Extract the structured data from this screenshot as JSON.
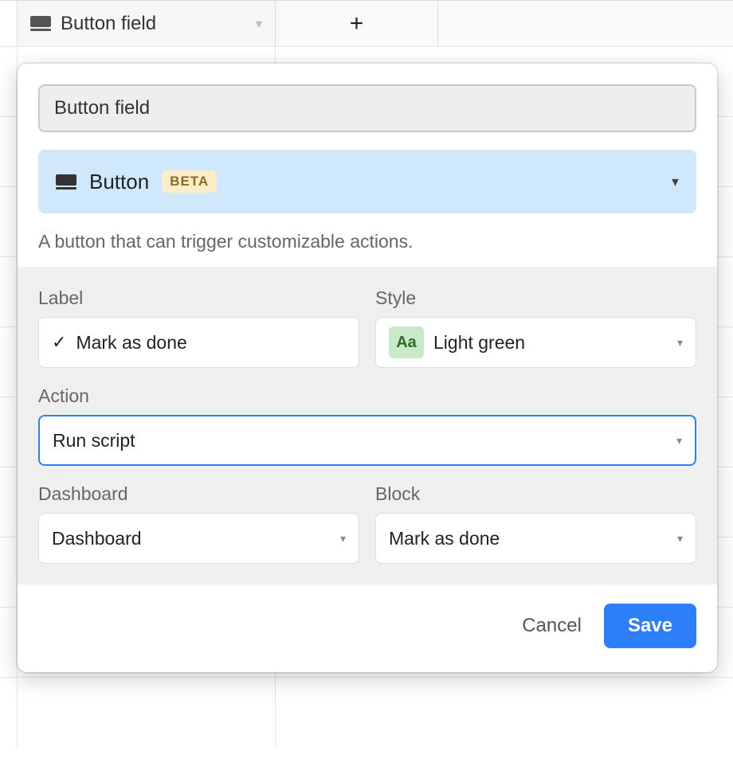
{
  "header": {
    "column_name": "Button field"
  },
  "popover": {
    "field_name_value": "Button field",
    "type": {
      "label": "Button",
      "badge": "BETA"
    },
    "description": "A button that can trigger customizable actions.",
    "labels": {
      "label": "Label",
      "style": "Style",
      "action": "Action",
      "dashboard": "Dashboard",
      "block": "Block"
    },
    "values": {
      "label_value": "Mark as done",
      "label_prefix": "✓",
      "style_badge": "Aa",
      "style_value": "Light green",
      "action_value": "Run script",
      "dashboard_value": "Dashboard",
      "block_value": "Mark as done"
    },
    "footer": {
      "cancel": "Cancel",
      "save": "Save"
    }
  }
}
